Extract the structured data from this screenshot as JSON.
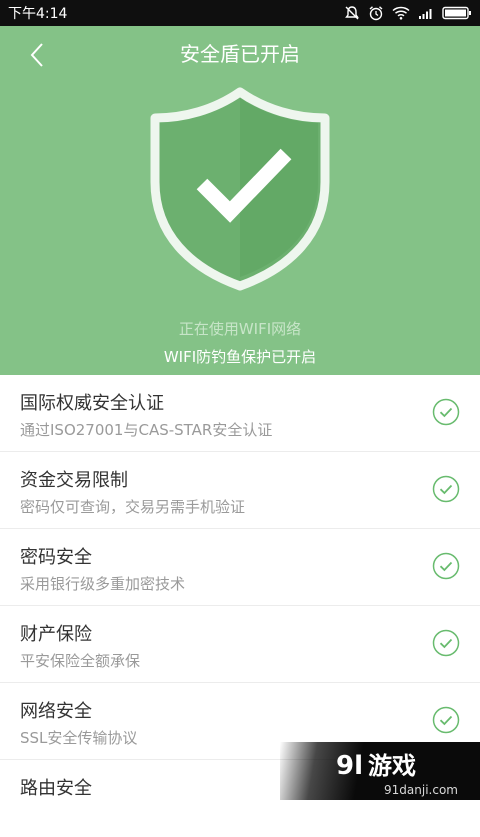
{
  "status_bar": {
    "time": "下午4:14",
    "icons": [
      "silent-icon",
      "alarm-icon",
      "wifi-icon",
      "signal-icon",
      "battery-icon"
    ]
  },
  "header": {
    "back_icon": "back-arrow-icon",
    "title": "安全盾已开启"
  },
  "hero": {
    "shield_icon": "shield-check-icon",
    "network_text": "正在使用WIFI网络",
    "status_text": "WIFI防钓鱼保护已开启"
  },
  "features": [
    {
      "title": "国际权威安全认证",
      "subtitle": "通过ISO27001与CAS-STAR安全认证"
    },
    {
      "title": "资金交易限制",
      "subtitle": "密码仅可查询，交易另需手机验证"
    },
    {
      "title": "密码安全",
      "subtitle": "采用银行级多重加密技术"
    },
    {
      "title": "财产保险",
      "subtitle": "平安保险全额承保"
    },
    {
      "title": "网络安全",
      "subtitle": "SSL安全传输协议"
    },
    {
      "title": "路由安全",
      "subtitle": ""
    }
  ],
  "watermark": {
    "brand": "9l游戏",
    "url": "91danji.com"
  },
  "colors": {
    "hero_bg": "#84c287",
    "accent_green": "#68bb6e",
    "status_bar_bg": "#0f0f0f"
  }
}
